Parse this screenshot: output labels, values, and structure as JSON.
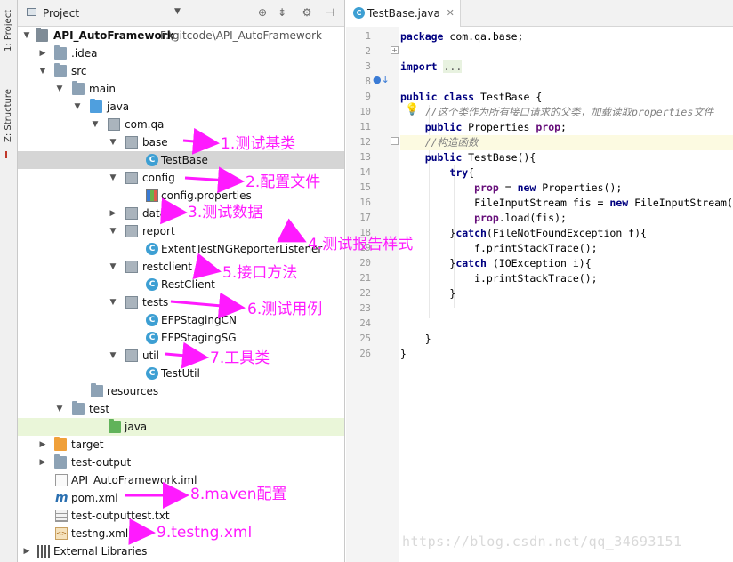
{
  "sidebar_tabs": {
    "project": "1: Project",
    "structure": "Z: Structure"
  },
  "project_panel": {
    "title": "Project",
    "tree": [
      {
        "label": "API_AutoFramework",
        "path": "F:\\gitcode\\API_AutoFramework",
        "icon": "module-folder-icon"
      },
      {
        "label": ".idea",
        "icon": "folder-icon"
      },
      {
        "label": "src",
        "icon": "folder-icon"
      },
      {
        "label": "main",
        "icon": "folder-icon"
      },
      {
        "label": "java",
        "icon": "source-folder-icon"
      },
      {
        "label": "com.qa",
        "icon": "package-icon"
      },
      {
        "label": "base",
        "icon": "package-icon"
      },
      {
        "label": "TestBase",
        "icon": "class-icon"
      },
      {
        "label": "config",
        "icon": "package-icon"
      },
      {
        "label": "config.properties",
        "icon": "properties-file-icon"
      },
      {
        "label": "data",
        "icon": "package-icon"
      },
      {
        "label": "report",
        "icon": "package-icon"
      },
      {
        "label": "ExtentTestNGReporterListener",
        "icon": "class-icon"
      },
      {
        "label": "restclient",
        "icon": "package-icon"
      },
      {
        "label": "RestClient",
        "icon": "class-icon"
      },
      {
        "label": "tests",
        "icon": "package-icon"
      },
      {
        "label": "EFPStagingCN",
        "icon": "test-class-icon"
      },
      {
        "label": "EFPStagingSG",
        "icon": "test-class-icon"
      },
      {
        "label": "util",
        "icon": "package-icon"
      },
      {
        "label": "TestUtil",
        "icon": "class-icon"
      },
      {
        "label": "resources",
        "icon": "resources-folder-icon"
      },
      {
        "label": "test",
        "icon": "folder-icon"
      },
      {
        "label": "java",
        "icon": "test-source-folder-icon"
      },
      {
        "label": "target",
        "icon": "excluded-folder-icon"
      },
      {
        "label": "test-output",
        "icon": "folder-icon"
      },
      {
        "label": "API_AutoFramework.iml",
        "icon": "iml-file-icon"
      },
      {
        "label": "pom.xml",
        "icon": "maven-icon"
      },
      {
        "label": "test-outputtest.txt",
        "icon": "text-file-icon"
      },
      {
        "label": "testng.xml",
        "icon": "xml-file-icon"
      },
      {
        "label": "External Libraries",
        "icon": "libraries-icon"
      }
    ]
  },
  "annotations": [
    "1.测试基类",
    "2.配置文件",
    "3.测试数据",
    "4.测试报告样式",
    "5.接口方法",
    "6.测试用例",
    "7.工具类",
    "8.maven配置",
    "9.testng.xml"
  ],
  "editor": {
    "tab_label": "TestBase.java",
    "line_numbers": [
      "1",
      "2",
      "3",
      "8",
      "9",
      "10",
      "11",
      "12",
      "13",
      "14",
      "15",
      "16",
      "17",
      "18",
      "19",
      "20",
      "21",
      "22",
      "23",
      "24",
      "25",
      "26"
    ],
    "lines": [
      "package com.qa.base;",
      "",
      "import ...",
      "",
      "public class TestBase {",
      "    //这个类作为所有接口请求的父类，加载读取properties文件",
      "    public Properties prop;",
      "    //构造函数",
      "    public TestBase(){",
      "        try{",
      "            prop = new Properties();",
      "            FileInputStream fis = new FileInputStream(",
      "            prop.load(fis);",
      "        }catch(FileNotFoundException f){",
      "            f.printStackTrace();",
      "        }catch (IOException i){",
      "            i.printStackTrace();",
      "        }",
      "",
      "",
      "    }",
      "}"
    ]
  },
  "watermark": "https://blog.csdn.net/qq_34693151"
}
